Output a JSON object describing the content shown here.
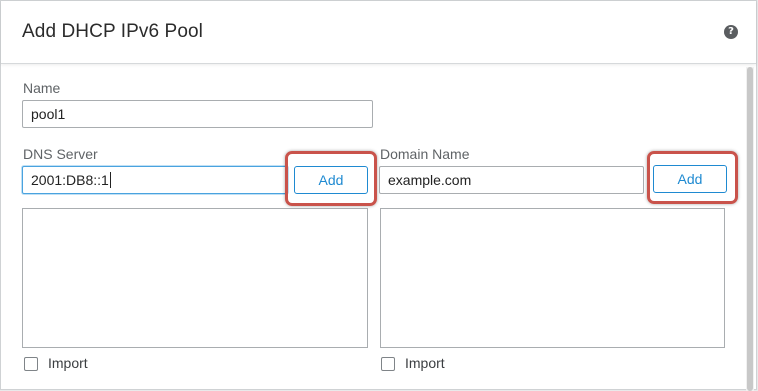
{
  "dialog": {
    "title": "Add DHCP IPv6 Pool",
    "help_icon": "?"
  },
  "name_field": {
    "label": "Name",
    "value": "pool1"
  },
  "dns_server": {
    "label": "DNS Server",
    "value": "2001:DB8::1",
    "add_label": "Add",
    "import_label": "Import",
    "import_checked": false
  },
  "domain_name": {
    "label": "Domain Name",
    "value": "example.com",
    "add_label": "Add",
    "import_label": "Import",
    "import_checked": false
  },
  "colors": {
    "accent": "#1f8ad1",
    "highlight_callout": "#c9534b"
  },
  "icons": {
    "help": "question-circle-icon"
  }
}
